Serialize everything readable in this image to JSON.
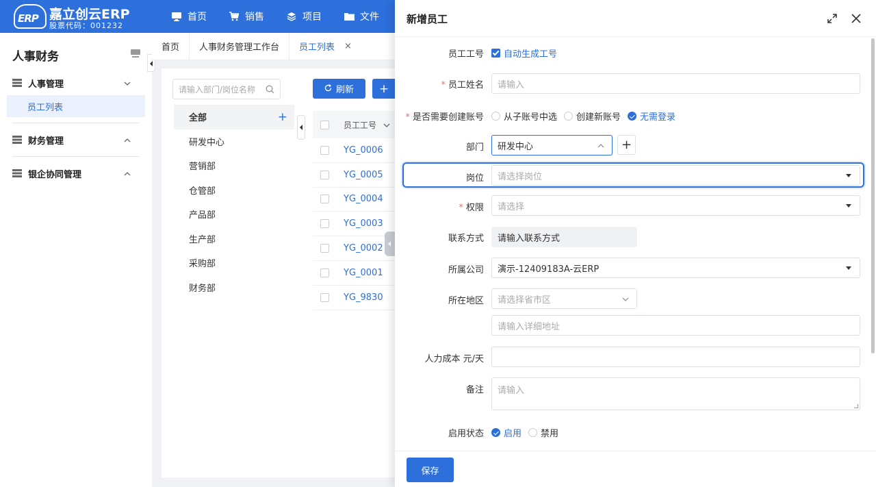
{
  "brand": {
    "logo_text": "ERP",
    "title": "嘉立创云ERP",
    "stock_code": "股票代码：001232"
  },
  "topnav": [
    {
      "label": "首页",
      "icon": "monitor-icon"
    },
    {
      "label": "销售",
      "icon": "cart-icon"
    },
    {
      "label": "项目",
      "icon": "layers-icon"
    },
    {
      "label": "文件",
      "icon": "folder-icon"
    }
  ],
  "sidebar": {
    "title": "人事财务",
    "groups": [
      {
        "label": "人事管理",
        "expanded": true,
        "items": [
          {
            "label": "员工列表",
            "active": true
          }
        ]
      },
      {
        "label": "财务管理",
        "expanded": false
      },
      {
        "label": "银企协同管理",
        "expanded": false
      }
    ]
  },
  "tabs": [
    {
      "label": "首页"
    },
    {
      "label": "人事财务管理工作台"
    },
    {
      "label": "员工列表",
      "active": true,
      "close": "×"
    }
  ],
  "list": {
    "search_placeholder": "请输入部门/岗位名称",
    "refresh_label": "刷新",
    "add_label": "+",
    "departments": [
      "全部",
      "研发中心",
      "营销部",
      "仓管部",
      "产品部",
      "生产部",
      "采购部",
      "财务部"
    ],
    "add_dept": "+",
    "column_header": "员工工号",
    "rows": [
      "YG_0006",
      "YG_0005",
      "YG_0004",
      "YG_0003",
      "YG_0002",
      "YG_0001",
      "YG_9830"
    ]
  },
  "drawer": {
    "title": "新增员工",
    "fields": {
      "emp_no": {
        "label": "员工工号",
        "checkbox": "自动生成工号"
      },
      "name": {
        "label": "员工姓名",
        "placeholder": "请输入"
      },
      "account": {
        "label": "是否需要创建账号",
        "options": [
          "从子账号中选",
          "创建新账号",
          "无需登录"
        ],
        "selected": "无需登录"
      },
      "dept": {
        "label": "部门",
        "value": "研发中心",
        "add": "+"
      },
      "post": {
        "label": "岗位",
        "placeholder": "请选择岗位"
      },
      "perm": {
        "label": "权限",
        "placeholder": "请选择"
      },
      "contact": {
        "label": "联系方式",
        "value": "请输入联系方式"
      },
      "company": {
        "label": "所属公司",
        "value": "演示-12409183A-云ERP"
      },
      "region": {
        "label": "所在地区",
        "placeholder": "请选择省市区",
        "address_placeholder": "请输入详细地址"
      },
      "cost": {
        "label": "人力成本 元/天",
        "value": ""
      },
      "remark": {
        "label": "备注",
        "placeholder": "请输入"
      },
      "status": {
        "label": "启用状态",
        "options": [
          "启用",
          "禁用"
        ],
        "selected": "启用"
      }
    },
    "save_label": "保存"
  },
  "colors": {
    "primary": "#2d6fdb",
    "required": "#f56c6c",
    "selected_bg": "#eaf1fd"
  }
}
